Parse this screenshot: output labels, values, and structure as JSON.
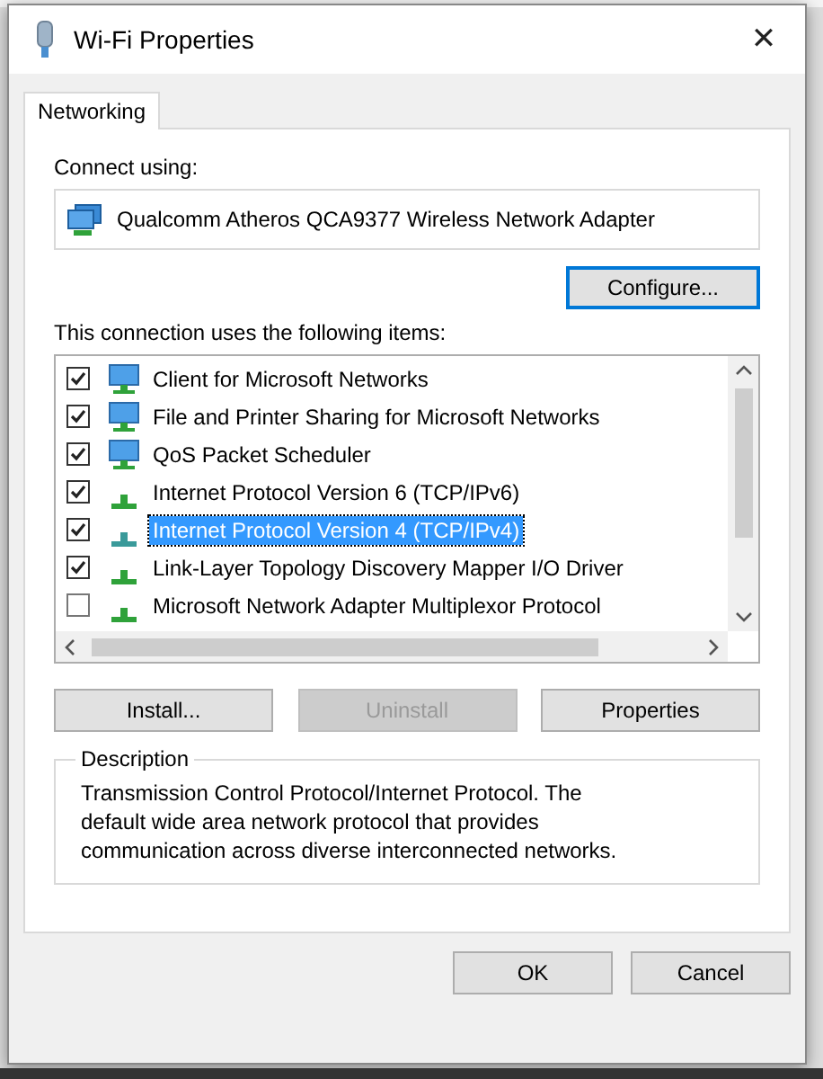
{
  "window": {
    "title": "Wi-Fi Properties",
    "close": "✕"
  },
  "tabs": [
    {
      "label": "Networking",
      "selected": true
    }
  ],
  "connect_using": {
    "label": "Connect using:",
    "adapter": "Qualcomm Atheros QCA9377 Wireless Network Adapter"
  },
  "configure_button": {
    "label": "Configure...",
    "focused": true
  },
  "items_label": "This connection uses the following items:",
  "items": [
    {
      "kind": "computer",
      "label": "Client for Microsoft Networks",
      "checked": true,
      "selected": false
    },
    {
      "kind": "computer",
      "label": "File and Printer Sharing for Microsoft Networks",
      "checked": true,
      "selected": false
    },
    {
      "kind": "computer",
      "label": "QoS Packet Scheduler",
      "checked": true,
      "selected": false
    },
    {
      "kind": "protocol",
      "label": "Internet Protocol Version 6 (TCP/IPv6)",
      "checked": true,
      "selected": false
    },
    {
      "kind": "protocol",
      "label": "Internet Protocol Version 4 (TCP/IPv4)",
      "checked": true,
      "selected": true
    },
    {
      "kind": "protocol",
      "label": "Link-Layer Topology Discovery Mapper I/O Driver",
      "checked": true,
      "selected": false
    },
    {
      "kind": "protocol",
      "label": "Microsoft Network Adapter Multiplexor Protocol",
      "checked": false,
      "selected": false
    }
  ],
  "item_buttons": [
    {
      "label": "Install...",
      "disabled": false
    },
    {
      "label": "Uninstall",
      "disabled": true
    },
    {
      "label": "Properties",
      "disabled": false
    }
  ],
  "description": {
    "legend": "Description",
    "text": "Transmission Control Protocol/Internet Protocol. The default wide area network protocol that provides communication across diverse interconnected networks."
  },
  "dialog_buttons": [
    {
      "label": "OK"
    },
    {
      "label": "Cancel"
    }
  ]
}
